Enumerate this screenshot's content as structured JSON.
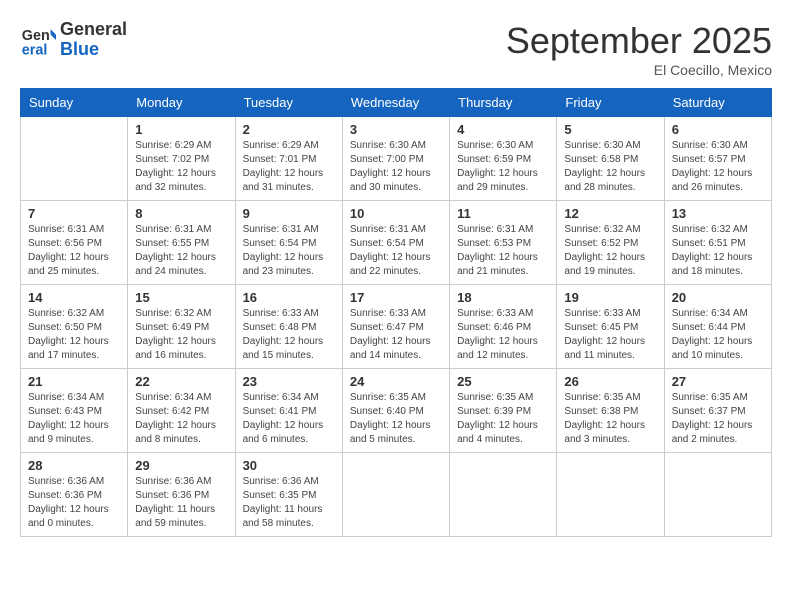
{
  "header": {
    "logo_line1": "General",
    "logo_line2": "Blue",
    "month_title": "September 2025",
    "subtitle": "El Coecillo, Mexico"
  },
  "days_of_week": [
    "Sunday",
    "Monday",
    "Tuesday",
    "Wednesday",
    "Thursday",
    "Friday",
    "Saturday"
  ],
  "weeks": [
    [
      {
        "day": "",
        "info": ""
      },
      {
        "day": "1",
        "info": "Sunrise: 6:29 AM\nSunset: 7:02 PM\nDaylight: 12 hours\nand 32 minutes."
      },
      {
        "day": "2",
        "info": "Sunrise: 6:29 AM\nSunset: 7:01 PM\nDaylight: 12 hours\nand 31 minutes."
      },
      {
        "day": "3",
        "info": "Sunrise: 6:30 AM\nSunset: 7:00 PM\nDaylight: 12 hours\nand 30 minutes."
      },
      {
        "day": "4",
        "info": "Sunrise: 6:30 AM\nSunset: 6:59 PM\nDaylight: 12 hours\nand 29 minutes."
      },
      {
        "day": "5",
        "info": "Sunrise: 6:30 AM\nSunset: 6:58 PM\nDaylight: 12 hours\nand 28 minutes."
      },
      {
        "day": "6",
        "info": "Sunrise: 6:30 AM\nSunset: 6:57 PM\nDaylight: 12 hours\nand 26 minutes."
      }
    ],
    [
      {
        "day": "7",
        "info": "Sunrise: 6:31 AM\nSunset: 6:56 PM\nDaylight: 12 hours\nand 25 minutes."
      },
      {
        "day": "8",
        "info": "Sunrise: 6:31 AM\nSunset: 6:55 PM\nDaylight: 12 hours\nand 24 minutes."
      },
      {
        "day": "9",
        "info": "Sunrise: 6:31 AM\nSunset: 6:54 PM\nDaylight: 12 hours\nand 23 minutes."
      },
      {
        "day": "10",
        "info": "Sunrise: 6:31 AM\nSunset: 6:54 PM\nDaylight: 12 hours\nand 22 minutes."
      },
      {
        "day": "11",
        "info": "Sunrise: 6:31 AM\nSunset: 6:53 PM\nDaylight: 12 hours\nand 21 minutes."
      },
      {
        "day": "12",
        "info": "Sunrise: 6:32 AM\nSunset: 6:52 PM\nDaylight: 12 hours\nand 19 minutes."
      },
      {
        "day": "13",
        "info": "Sunrise: 6:32 AM\nSunset: 6:51 PM\nDaylight: 12 hours\nand 18 minutes."
      }
    ],
    [
      {
        "day": "14",
        "info": "Sunrise: 6:32 AM\nSunset: 6:50 PM\nDaylight: 12 hours\nand 17 minutes."
      },
      {
        "day": "15",
        "info": "Sunrise: 6:32 AM\nSunset: 6:49 PM\nDaylight: 12 hours\nand 16 minutes."
      },
      {
        "day": "16",
        "info": "Sunrise: 6:33 AM\nSunset: 6:48 PM\nDaylight: 12 hours\nand 15 minutes."
      },
      {
        "day": "17",
        "info": "Sunrise: 6:33 AM\nSunset: 6:47 PM\nDaylight: 12 hours\nand 14 minutes."
      },
      {
        "day": "18",
        "info": "Sunrise: 6:33 AM\nSunset: 6:46 PM\nDaylight: 12 hours\nand 12 minutes."
      },
      {
        "day": "19",
        "info": "Sunrise: 6:33 AM\nSunset: 6:45 PM\nDaylight: 12 hours\nand 11 minutes."
      },
      {
        "day": "20",
        "info": "Sunrise: 6:34 AM\nSunset: 6:44 PM\nDaylight: 12 hours\nand 10 minutes."
      }
    ],
    [
      {
        "day": "21",
        "info": "Sunrise: 6:34 AM\nSunset: 6:43 PM\nDaylight: 12 hours\nand 9 minutes."
      },
      {
        "day": "22",
        "info": "Sunrise: 6:34 AM\nSunset: 6:42 PM\nDaylight: 12 hours\nand 8 minutes."
      },
      {
        "day": "23",
        "info": "Sunrise: 6:34 AM\nSunset: 6:41 PM\nDaylight: 12 hours\nand 6 minutes."
      },
      {
        "day": "24",
        "info": "Sunrise: 6:35 AM\nSunset: 6:40 PM\nDaylight: 12 hours\nand 5 minutes."
      },
      {
        "day": "25",
        "info": "Sunrise: 6:35 AM\nSunset: 6:39 PM\nDaylight: 12 hours\nand 4 minutes."
      },
      {
        "day": "26",
        "info": "Sunrise: 6:35 AM\nSunset: 6:38 PM\nDaylight: 12 hours\nand 3 minutes."
      },
      {
        "day": "27",
        "info": "Sunrise: 6:35 AM\nSunset: 6:37 PM\nDaylight: 12 hours\nand 2 minutes."
      }
    ],
    [
      {
        "day": "28",
        "info": "Sunrise: 6:36 AM\nSunset: 6:36 PM\nDaylight: 12 hours\nand 0 minutes."
      },
      {
        "day": "29",
        "info": "Sunrise: 6:36 AM\nSunset: 6:36 PM\nDaylight: 11 hours\nand 59 minutes."
      },
      {
        "day": "30",
        "info": "Sunrise: 6:36 AM\nSunset: 6:35 PM\nDaylight: 11 hours\nand 58 minutes."
      },
      {
        "day": "",
        "info": ""
      },
      {
        "day": "",
        "info": ""
      },
      {
        "day": "",
        "info": ""
      },
      {
        "day": "",
        "info": ""
      }
    ]
  ]
}
